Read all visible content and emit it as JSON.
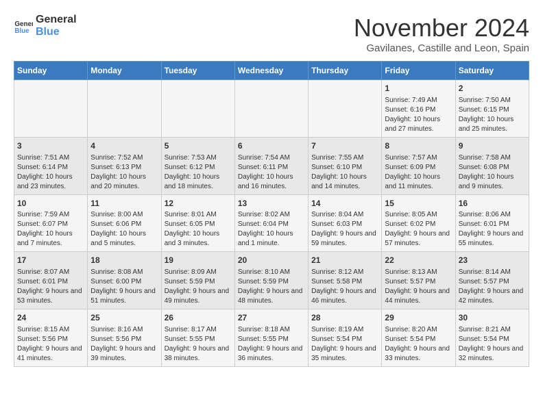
{
  "logo": {
    "text_general": "General",
    "text_blue": "Blue"
  },
  "header": {
    "month": "November 2024",
    "location": "Gavilanes, Castille and Leon, Spain"
  },
  "weekdays": [
    "Sunday",
    "Monday",
    "Tuesday",
    "Wednesday",
    "Thursday",
    "Friday",
    "Saturday"
  ],
  "weeks": [
    [
      {
        "day": "",
        "content": ""
      },
      {
        "day": "",
        "content": ""
      },
      {
        "day": "",
        "content": ""
      },
      {
        "day": "",
        "content": ""
      },
      {
        "day": "",
        "content": ""
      },
      {
        "day": "1",
        "content": "Sunrise: 7:49 AM\nSunset: 6:16 PM\nDaylight: 10 hours and 27 minutes."
      },
      {
        "day": "2",
        "content": "Sunrise: 7:50 AM\nSunset: 6:15 PM\nDaylight: 10 hours and 25 minutes."
      }
    ],
    [
      {
        "day": "3",
        "content": "Sunrise: 7:51 AM\nSunset: 6:14 PM\nDaylight: 10 hours and 23 minutes."
      },
      {
        "day": "4",
        "content": "Sunrise: 7:52 AM\nSunset: 6:13 PM\nDaylight: 10 hours and 20 minutes."
      },
      {
        "day": "5",
        "content": "Sunrise: 7:53 AM\nSunset: 6:12 PM\nDaylight: 10 hours and 18 minutes."
      },
      {
        "day": "6",
        "content": "Sunrise: 7:54 AM\nSunset: 6:11 PM\nDaylight: 10 hours and 16 minutes."
      },
      {
        "day": "7",
        "content": "Sunrise: 7:55 AM\nSunset: 6:10 PM\nDaylight: 10 hours and 14 minutes."
      },
      {
        "day": "8",
        "content": "Sunrise: 7:57 AM\nSunset: 6:09 PM\nDaylight: 10 hours and 11 minutes."
      },
      {
        "day": "9",
        "content": "Sunrise: 7:58 AM\nSunset: 6:08 PM\nDaylight: 10 hours and 9 minutes."
      }
    ],
    [
      {
        "day": "10",
        "content": "Sunrise: 7:59 AM\nSunset: 6:07 PM\nDaylight: 10 hours and 7 minutes."
      },
      {
        "day": "11",
        "content": "Sunrise: 8:00 AM\nSunset: 6:06 PM\nDaylight: 10 hours and 5 minutes."
      },
      {
        "day": "12",
        "content": "Sunrise: 8:01 AM\nSunset: 6:05 PM\nDaylight: 10 hours and 3 minutes."
      },
      {
        "day": "13",
        "content": "Sunrise: 8:02 AM\nSunset: 6:04 PM\nDaylight: 10 hours and 1 minute."
      },
      {
        "day": "14",
        "content": "Sunrise: 8:04 AM\nSunset: 6:03 PM\nDaylight: 9 hours and 59 minutes."
      },
      {
        "day": "15",
        "content": "Sunrise: 8:05 AM\nSunset: 6:02 PM\nDaylight: 9 hours and 57 minutes."
      },
      {
        "day": "16",
        "content": "Sunrise: 8:06 AM\nSunset: 6:01 PM\nDaylight: 9 hours and 55 minutes."
      }
    ],
    [
      {
        "day": "17",
        "content": "Sunrise: 8:07 AM\nSunset: 6:01 PM\nDaylight: 9 hours and 53 minutes."
      },
      {
        "day": "18",
        "content": "Sunrise: 8:08 AM\nSunset: 6:00 PM\nDaylight: 9 hours and 51 minutes."
      },
      {
        "day": "19",
        "content": "Sunrise: 8:09 AM\nSunset: 5:59 PM\nDaylight: 9 hours and 49 minutes."
      },
      {
        "day": "20",
        "content": "Sunrise: 8:10 AM\nSunset: 5:59 PM\nDaylight: 9 hours and 48 minutes."
      },
      {
        "day": "21",
        "content": "Sunrise: 8:12 AM\nSunset: 5:58 PM\nDaylight: 9 hours and 46 minutes."
      },
      {
        "day": "22",
        "content": "Sunrise: 8:13 AM\nSunset: 5:57 PM\nDaylight: 9 hours and 44 minutes."
      },
      {
        "day": "23",
        "content": "Sunrise: 8:14 AM\nSunset: 5:57 PM\nDaylight: 9 hours and 42 minutes."
      }
    ],
    [
      {
        "day": "24",
        "content": "Sunrise: 8:15 AM\nSunset: 5:56 PM\nDaylight: 9 hours and 41 minutes."
      },
      {
        "day": "25",
        "content": "Sunrise: 8:16 AM\nSunset: 5:56 PM\nDaylight: 9 hours and 39 minutes."
      },
      {
        "day": "26",
        "content": "Sunrise: 8:17 AM\nSunset: 5:55 PM\nDaylight: 9 hours and 38 minutes."
      },
      {
        "day": "27",
        "content": "Sunrise: 8:18 AM\nSunset: 5:55 PM\nDaylight: 9 hours and 36 minutes."
      },
      {
        "day": "28",
        "content": "Sunrise: 8:19 AM\nSunset: 5:54 PM\nDaylight: 9 hours and 35 minutes."
      },
      {
        "day": "29",
        "content": "Sunrise: 8:20 AM\nSunset: 5:54 PM\nDaylight: 9 hours and 33 minutes."
      },
      {
        "day": "30",
        "content": "Sunrise: 8:21 AM\nSunset: 5:54 PM\nDaylight: 9 hours and 32 minutes."
      }
    ]
  ]
}
